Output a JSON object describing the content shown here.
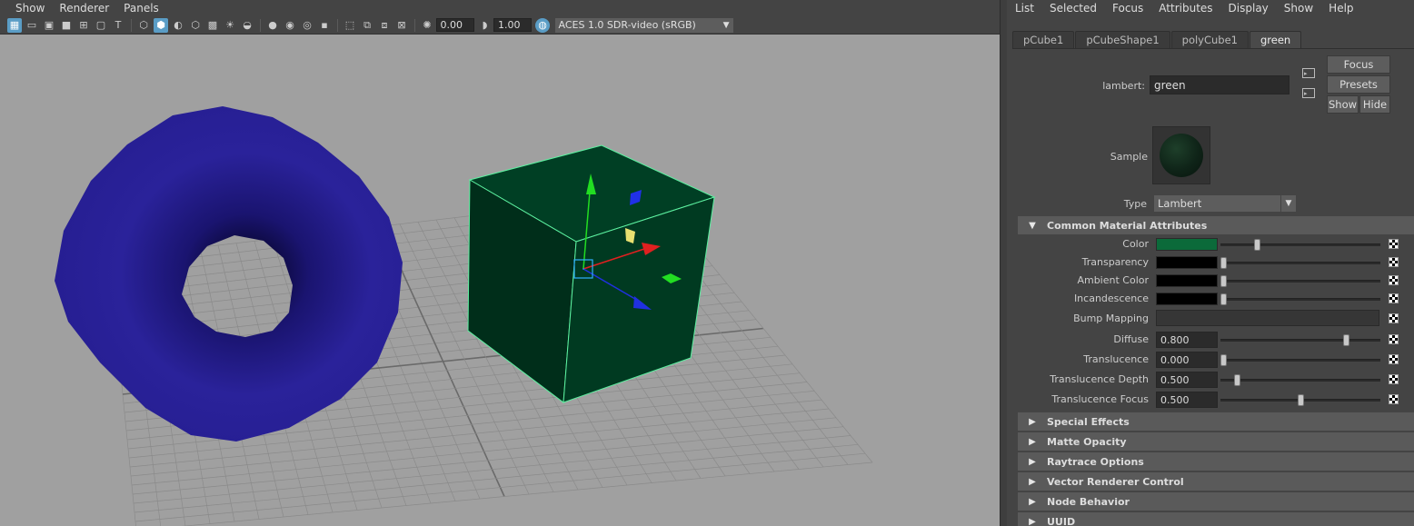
{
  "viewport": {
    "menus": [
      "Show",
      "Renderer",
      "Panels"
    ],
    "exposure_value": "0.00",
    "gamma_value": "1.00",
    "color_space": "ACES 1.0 SDR-video (sRGB)"
  },
  "attribute_editor": {
    "menus": [
      "List",
      "Selected",
      "Focus",
      "Attributes",
      "Display",
      "Show",
      "Help"
    ],
    "tabs": [
      {
        "label": "pCube1",
        "active": false
      },
      {
        "label": "pCubeShape1",
        "active": false
      },
      {
        "label": "polyCube1",
        "active": false
      },
      {
        "label": "green",
        "active": true
      }
    ],
    "lambert_label": "lambert:",
    "lambert_name": "green",
    "focus_button": "Focus",
    "presets_button": "Presets",
    "show_button": "Show",
    "hide_button": "Hide",
    "sample_label": "Sample",
    "type_label": "Type",
    "type_value": "Lambert",
    "common_section": "Common Material Attributes",
    "attributes": [
      {
        "label": "Color",
        "kind": "swatch",
        "color": "#0b6a3a",
        "level": 0.22
      },
      {
        "label": "Transparency",
        "kind": "swatch",
        "color": "#000000",
        "level": 0.0
      },
      {
        "label": "Ambient Color",
        "kind": "swatch",
        "color": "#000000",
        "level": 0.0
      },
      {
        "label": "Incandescence",
        "kind": "swatch",
        "color": "#000000",
        "level": 0.0
      },
      {
        "label": "Bump Mapping",
        "kind": "bump"
      },
      {
        "label": "Diffuse",
        "kind": "number",
        "value": "0.800",
        "level": 0.8
      },
      {
        "label": "Translucence",
        "kind": "number",
        "value": "0.000",
        "level": 0.0
      },
      {
        "label": "Translucence Depth",
        "kind": "number",
        "value": "0.500",
        "level": 0.09
      },
      {
        "label": "Translucence Focus",
        "kind": "number",
        "value": "0.500",
        "level": 0.5
      }
    ],
    "collapsed_sections": [
      "Special Effects",
      "Matte Opacity",
      "Raytrace Options",
      "Vector Renderer Control",
      "Node Behavior",
      "UUID"
    ]
  },
  "colors": {
    "torus": "#2a229a",
    "cube": "#004a2a",
    "cube_highlight": "#5cf0a0",
    "grid": "#8a8a8a"
  }
}
